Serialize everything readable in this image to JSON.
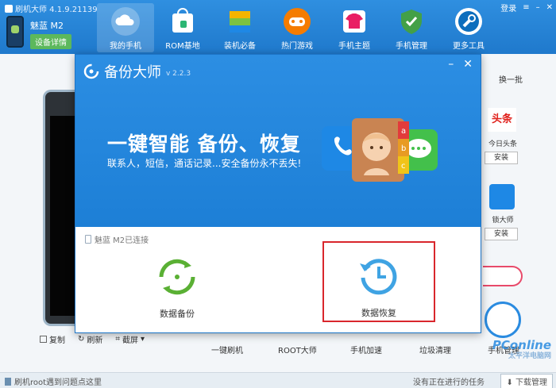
{
  "app": {
    "title": "刷机大师 4.1.9.21139",
    "login": "登录",
    "device": {
      "name": "魅蓝 M2",
      "details_button": "设备详情"
    },
    "nav": [
      {
        "label": "我的手机",
        "icon": "cloud-icon",
        "active": true,
        "color": "#ffffff"
      },
      {
        "label": "ROM基地",
        "icon": "rom-bag-icon",
        "active": false,
        "color": "#2bb673"
      },
      {
        "label": "装机必备",
        "icon": "app-stack-icon",
        "active": false,
        "color": "#f4b400"
      },
      {
        "label": "热门游戏",
        "icon": "gamepad-icon",
        "active": false,
        "color": "#f57c00"
      },
      {
        "label": "手机主题",
        "icon": "tshirt-icon",
        "active": false,
        "color": "#e91e63"
      },
      {
        "label": "手机管理",
        "icon": "shield-icon",
        "active": false,
        "color": "#43a047"
      },
      {
        "label": "更多工具",
        "icon": "wrench-icon",
        "active": false,
        "color": "#0d6ebd"
      }
    ],
    "left_toolbar": {
      "copy": "复制",
      "refresh": "刷新",
      "screenshot": "截屏"
    },
    "quick_actions": [
      "一键刷机",
      "ROOT大师",
      "手机加速",
      "垃圾清理",
      "手机管理"
    ],
    "status": {
      "left": "刷机root遇到问题点这里",
      "right": "没有正在进行的任务",
      "download": "下载管理"
    },
    "recommend": {
      "header": "换一批",
      "items": [
        {
          "name": "今日头条",
          "logo": "头条",
          "install": "安装"
        },
        {
          "name": "锁大师",
          "install": "安装"
        }
      ]
    },
    "watermark": {
      "title": "PConline",
      "subtitle": "太平洋电脑网"
    }
  },
  "dialog": {
    "title": "备份大师",
    "version": "v 2.2.3",
    "headline": "一键智能 备份、恢复",
    "subline": "联系人，短信，通话记录...安全备份永不丢失!",
    "connection": "魅蓝 M2已连接",
    "options": [
      {
        "label": "数据备份",
        "icon": "backup-cycle-icon",
        "color": "#5ab034"
      },
      {
        "label": "数据恢复",
        "icon": "restore-clock-icon",
        "color": "#3fa3e3",
        "highlighted": true
      }
    ],
    "highlight_color": "#d9262c"
  }
}
